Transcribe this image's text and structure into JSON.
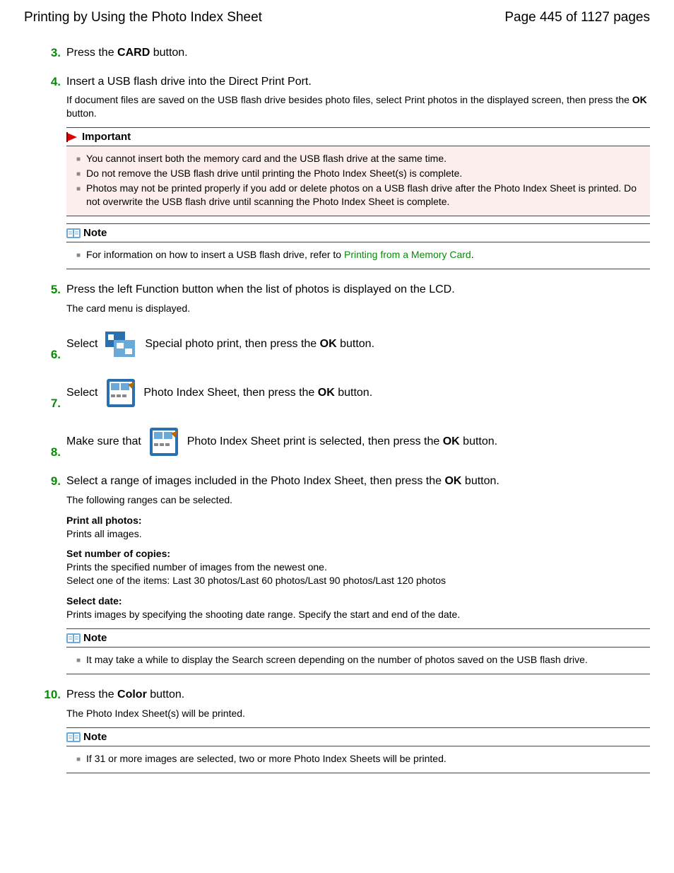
{
  "header": {
    "title": "Printing by Using the Photo Index Sheet",
    "page_indicator": "Page 445 of 1127 pages"
  },
  "steps": {
    "s3": {
      "num": "3.",
      "text_a": "Press the ",
      "btn": "CARD",
      "text_b": " button."
    },
    "s4": {
      "num": "4.",
      "title": "Insert a USB flash drive into the Direct Print Port.",
      "sub_a": "If document files are saved on the USB flash drive besides photo files, select Print photos in the displayed screen, then press the ",
      "ok": "OK",
      "sub_b": " button.",
      "important": {
        "label": "Important",
        "i1": "You cannot insert both the memory card and the USB flash drive at the same time.",
        "i2": "Do not remove the USB flash drive until printing the Photo Index Sheet(s) is complete.",
        "i3": "Photos may not be printed properly if you add or delete photos on a USB flash drive after the Photo Index Sheet is printed. Do not overwrite the USB flash drive until scanning the Photo Index Sheet is complete."
      },
      "note": {
        "label": "Note",
        "n1a": "For information on how to insert a USB flash drive, refer to ",
        "n1link": "Printing from a Memory Card",
        "n1b": "."
      }
    },
    "s5": {
      "num": "5.",
      "title": "Press the left Function button when the list of photos is displayed on the LCD.",
      "sub": "The card menu is displayed."
    },
    "s6": {
      "num": "6.",
      "a": "Select ",
      "b": " Special photo print, then press the ",
      "ok": "OK",
      "c": " button."
    },
    "s7": {
      "num": "7.",
      "a": "Select ",
      "b": " Photo Index Sheet, then press the ",
      "ok": "OK",
      "c": " button."
    },
    "s8": {
      "num": "8.",
      "a": "Make sure that ",
      "b": " Photo Index Sheet print is selected, then press the ",
      "ok": "OK",
      "c": " button."
    },
    "s9": {
      "num": "9.",
      "title_a": "Select a range of images included in the Photo Index Sheet, then press the ",
      "ok": "OK",
      "title_b": " button.",
      "sub": "The following ranges can be selected.",
      "r1t": "Print all photos:",
      "r1b": "Prints all images.",
      "r2t": "Set number of copies:",
      "r2b1": "Prints the specified number of images from the newest one.",
      "r2b2": "Select one of the items: Last 30 photos/Last 60 photos/Last 90 photos/Last 120 photos",
      "r3t": "Select date:",
      "r3b": "Prints images by specifying the shooting date range. Specify the start and end of the date.",
      "note": {
        "label": "Note",
        "n1": "It may take a while to display the Search screen depending on the number of photos saved on the USB flash drive."
      }
    },
    "s10": {
      "num": "10.",
      "a": "Press the ",
      "btn": "Color",
      "b": " button.",
      "sub": "The Photo Index Sheet(s) will be printed.",
      "note": {
        "label": "Note",
        "n1": "If 31 or more images are selected, two or more Photo Index Sheets will be printed."
      }
    }
  }
}
